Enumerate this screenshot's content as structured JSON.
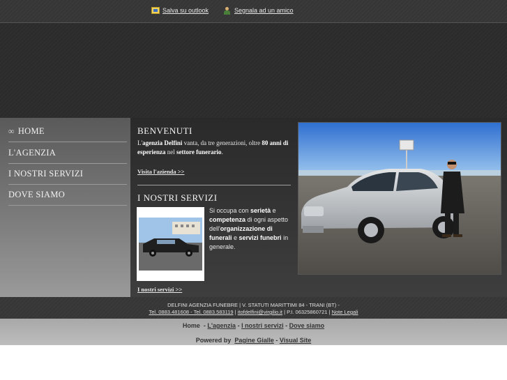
{
  "topbar": {
    "outlook_label": "Salva su outlook",
    "segnala_label": "Segnala ad un amico"
  },
  "nav": {
    "items": [
      {
        "label": "HOME",
        "icon": "swirl-icon"
      },
      {
        "label": "L'AGENZIA"
      },
      {
        "label": "I NOSTRI SERVIZI"
      },
      {
        "label": "DOVE SIAMO"
      }
    ]
  },
  "benvenuti": {
    "title": "BENVENUTI",
    "text_parts": [
      "L'",
      "agenzia Delfini",
      " vanta, da tre generazioni, oltre ",
      "80 anni di esperienza",
      " nel ",
      "settore funerario",
      "."
    ],
    "link": "Visita l'azienda >>"
  },
  "servizi": {
    "title": "I NOSTRI SERVIZI",
    "text_parts": [
      " Si occupa con ",
      "serietà",
      " e ",
      "competenza",
      " di ogni aspetto dell'",
      "organizzazione di funerali",
      " e ",
      "servizi funebri",
      " in generale."
    ],
    "link": "I nostri servizi >>"
  },
  "footer": {
    "address": "DELFINI AGENZIA FUNEBRE | V. STATUTI MARITTIMI 84 - TRANI (BT) -",
    "tel": "Tel. 0883.481608 - Tel. 0883.583119",
    "email": "itofdelfini@virgilio.it",
    "piva": "P.I. 06325860721",
    "legal": "Note Legali",
    "nav": [
      "Home",
      "L'agenzia",
      "I nostri servizi",
      "Dove siamo"
    ],
    "powered_by": "Powered by",
    "pagine_gialle": "Pagine Gialle",
    "visual_site": "Visual Site"
  }
}
